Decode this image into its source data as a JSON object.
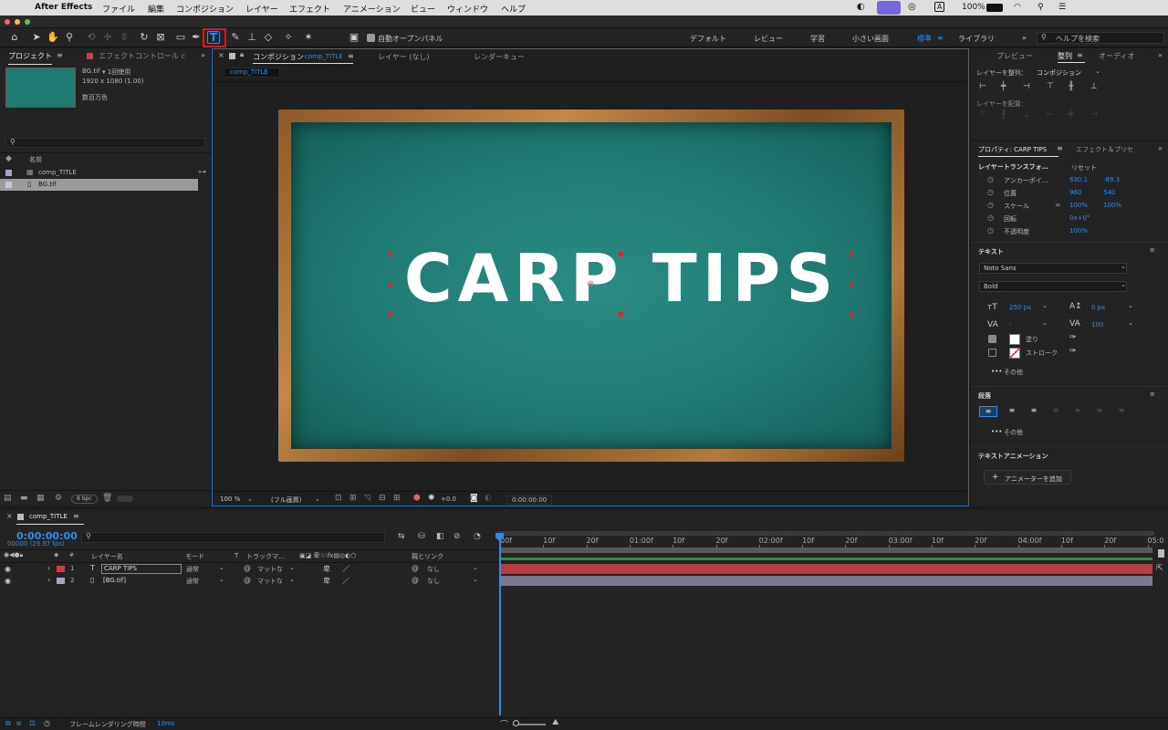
{
  "menubar": {
    "app": "After Effects",
    "items": [
      "ファイル",
      "編集",
      "コンポジション",
      "レイヤー",
      "エフェクト",
      "アニメーション",
      "ビュー",
      "ウィンドウ",
      "ヘルプ"
    ],
    "battery": "100%"
  },
  "toolbar": {
    "auto_open_panels": "自動オープンパネル",
    "workspaces": [
      "デフォルト",
      "レビュー",
      "学習",
      "小さい画面",
      "標準",
      "ライブラリ"
    ],
    "active_workspace": "標準",
    "help_search": "ヘルプを検索"
  },
  "project": {
    "tab_project": "プロジェクト",
    "tab_effect_controls": "エフェクトコントロール c",
    "item_name": "BG.tif",
    "item_used": "▾ 1回使用",
    "item_dims": "1920 x 1080 (1.00)",
    "item_color": "数百万色",
    "col_name": "名前",
    "items": [
      "comp_TITLE",
      "BG.tif"
    ],
    "bpc": "8 bpc"
  },
  "viewer": {
    "tab_composition": "コンポジション",
    "comp_name": "comp_TITLE",
    "tab_layer": "レイヤー (なし)",
    "tab_render": "レンダーキュー",
    "breadcrumb": "comp_TITLE",
    "title_text": "CARP TIPS",
    "zoom": "100 %",
    "resolution": "(フル画質)",
    "exposure": "+0.0",
    "timecode": "0:00:00:00"
  },
  "right": {
    "tab_preview": "プレビュー",
    "tab_align": "整列",
    "tab_audio": "オーディオ",
    "align_to_label": "レイヤーを整列：",
    "align_to_value": "コンポジション",
    "distribute_label": "レイヤーを配置：",
    "tab_properties": "プロパティ: CARP TIPS",
    "tab_effects_presets": "エフェクト＆プリセ",
    "layer_transform": "レイヤートランスフォ…",
    "reset": "リセット",
    "props": [
      {
        "name": "アンカーポイ…",
        "v1": "630.1",
        "v2": "-89.3"
      },
      {
        "name": "位置",
        "v1": "960",
        "v2": "540"
      },
      {
        "name": "スケール",
        "v1": "100%",
        "v2": "100%"
      },
      {
        "name": "回転",
        "v1": "0x+0°",
        "v2": ""
      },
      {
        "name": "不透明度",
        "v1": "100%",
        "v2": ""
      }
    ],
    "text_section": "テキスト",
    "font": "Noto Sans",
    "style": "Bold",
    "font_size": "250 px",
    "leading": "0 px",
    "kerning": "-",
    "tracking": "100",
    "fill": "塗り",
    "stroke": "ストローク",
    "more": "その他",
    "paragraph": "段落",
    "more2": "その他",
    "text_animation": "テキストアニメーション",
    "add_animator": "アニメーターを追加"
  },
  "timeline": {
    "comp_tab": "comp_TITLE",
    "timecode": "0:00:00:00",
    "frame_info": "00000 (29.97 fps)",
    "col_layer_name": "レイヤー名",
    "col_mode": "モード",
    "col_t": "T",
    "col_track": "トラックマ…",
    "col_parent": "親とリンク",
    "layers": [
      {
        "num": "1",
        "name": "CARP TIPS",
        "mode": "通常",
        "track": "マットな",
        "parent": "なし",
        "color": "#c4434a",
        "bar": "#b24045"
      },
      {
        "num": "2",
        "name": "[BG.tif]",
        "mode": "通常",
        "track": "マットな",
        "parent": "なし",
        "color": "#a9a1c8",
        "bar": "#7c7890"
      }
    ],
    "ruler": [
      "00f",
      "10f",
      "20f",
      "01:00f",
      "10f",
      "20f",
      "02:00f",
      "10f",
      "20f",
      "03:00f",
      "10f",
      "20f",
      "04:00f",
      "10f",
      "20f",
      "05:0"
    ],
    "render_time_label": "フレームレンダリング時間",
    "render_time": "10ms"
  },
  "colors": {
    "accent": "#2d8ceb",
    "highlight": "#e8101a",
    "board": "#1f7a72"
  }
}
